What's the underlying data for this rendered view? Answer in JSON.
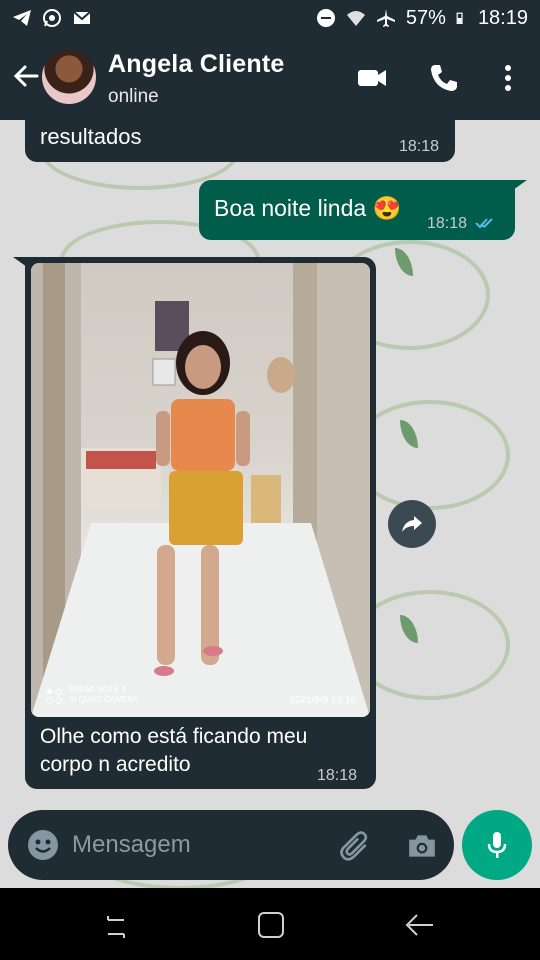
{
  "status_bar": {
    "battery": "57%",
    "time": "18:19",
    "icons": [
      "telegram-icon",
      "whatsapp-icon",
      "gmail-icon",
      "dnd-icon",
      "wifi-icon",
      "airplane-icon",
      "battery-icon"
    ]
  },
  "header": {
    "contact_name": "Angela Cliente",
    "status": "online",
    "icons": [
      "back-arrow-icon",
      "avatar",
      "video-call-icon",
      "phone-icon",
      "more-vert-icon"
    ]
  },
  "messages": [
    {
      "direction": "incoming",
      "text": "resultados",
      "time": "18:18"
    },
    {
      "direction": "outgoing",
      "text": "Boa noite linda 😍",
      "time": "18:18",
      "read": true
    },
    {
      "direction": "incoming",
      "type": "image",
      "photo_caption_line1": "REDMI NOTE 9",
      "photo_caption_line2": "AI QUAD CAMERA",
      "photo_datetime": "2021/9/9 18:16",
      "caption_line1": "Olhe como está ficando meu",
      "caption_line2": "corpo n acredito",
      "time": "18:18"
    }
  ],
  "composer": {
    "placeholder": "Mensagem"
  },
  "colors": {
    "header_bg": "#1f2c34",
    "incoming_bubble": "#1f2c34",
    "outgoing_bubble": "#005c4b",
    "accent": "#00a884",
    "read_ticks": "#53bdeb"
  }
}
